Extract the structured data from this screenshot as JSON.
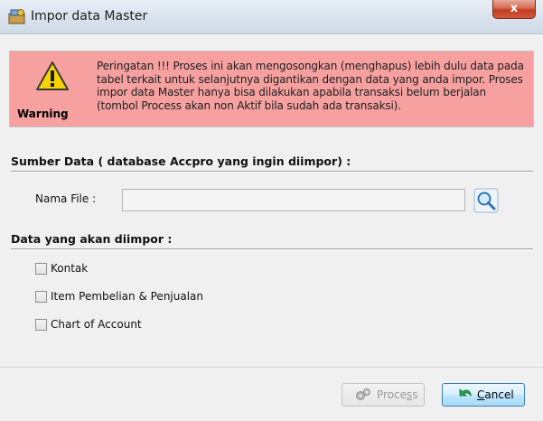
{
  "window": {
    "title": "Impor data Master",
    "close_label": "x"
  },
  "warning": {
    "label": "Warning",
    "message": "Peringatan !!!  Proses ini akan mengosongkan (menghapus) lebih dulu data pada tabel terkait untuk selanjutnya digantikan dengan data yang anda impor. Proses impor data Master hanya bisa dilakukan apabila transaksi belum berjalan (tombol Process akan non Aktif bila sudah ada transaksi)."
  },
  "source": {
    "section_title": "Sumber Data ( database Accpro yang ingin diimpor) :",
    "file_label": "Nama File :",
    "file_value": "",
    "browse_icon": "magnifier-icon"
  },
  "import": {
    "section_title": "Data yang akan diimpor :",
    "options": [
      {
        "label": "Kontak",
        "checked": false
      },
      {
        "label": "Item Pembelian & Penjualan",
        "checked": false
      },
      {
        "label": "Chart of Account",
        "checked": false
      }
    ]
  },
  "buttons": {
    "process": {
      "pre": "Proce",
      "mnemonic": "s",
      "post": "s",
      "enabled": false
    },
    "cancel": {
      "pre": "",
      "mnemonic": "C",
      "post": "ancel",
      "enabled": true
    }
  },
  "colors": {
    "warning_bg": "#f6a0a0",
    "window_bg": "#f0f0f0",
    "close_red": "#c23b22"
  }
}
